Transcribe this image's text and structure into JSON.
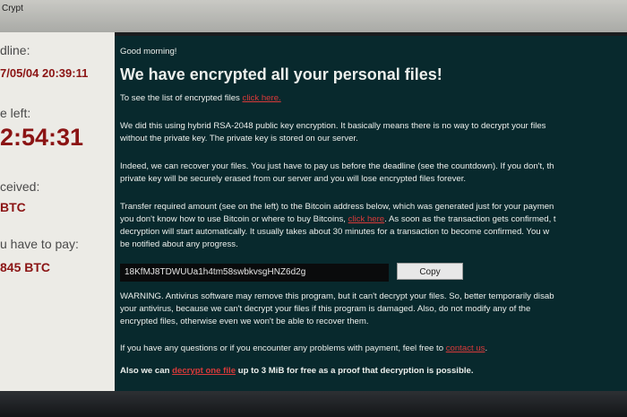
{
  "window": {
    "title": "Crypt"
  },
  "left_panel": {
    "deadline_label": "dline:",
    "deadline_value": "7/05/04 20:39:11",
    "time_left_label": "e left:",
    "countdown": "2:54:31",
    "received_label": "ceived:",
    "received_value": "BTC",
    "to_pay_label": "u have to pay:",
    "to_pay_value": "845 BTC"
  },
  "main": {
    "greeting": "Good morning!",
    "heading": "We have encrypted all your personal files!",
    "see_list_text": "To see the list of encrypted files",
    "see_list_link": "click here.",
    "p1_l1": "We did this using hybrid RSA-2048 public key encryption. It basically means there is no way to decrypt your files",
    "p1_l2": "without the private key. The private key is stored on our server.",
    "p2_l1": "Indeed, we can recover your files. You just have to pay us before the deadline (see the countdown). If you don't, th",
    "p2_l2": "private key will be securely erased from our server and you will lose encrypted files forever.",
    "p3_l1": "Transfer required amount (see on the left) to the Bitcoin address below, which was generated just for your paymen",
    "p3_l2_a": "you don't know how to use Bitcoin or where to buy Bitcoins,",
    "p3_l2_link": "click here",
    "p3_l2_b": ". As soon as the transaction gets confirmed, t",
    "p3_l3": "decryption will start automatically. It usually takes about 30 minutes for a transaction to become confirmed. You w",
    "p3_l4": "be notified about any progress.",
    "bitcoin_address": "18KfMJ8TDWUUa1h4tm58swbkvsgHNZ6d2g",
    "copy_label": "Copy",
    "warn_l1": "WARNING. Antivirus software may remove this program, but it can't decrypt your files. So, better temporarily disab",
    "warn_l2": "your antivirus, because we can't decrypt your files if this program is damaged. Also, do not modify any of the",
    "warn_l3": "encrypted files, otherwise even we won't be able to recover them.",
    "contact_text": "If you have any questions or if you encounter any problems with payment, feel free to",
    "contact_link": "contact us",
    "contact_end": ".",
    "free_a": "Also we can",
    "free_link": "decrypt one file",
    "free_b": "up to 3 MiB for free as a proof that decryption is possible."
  }
}
